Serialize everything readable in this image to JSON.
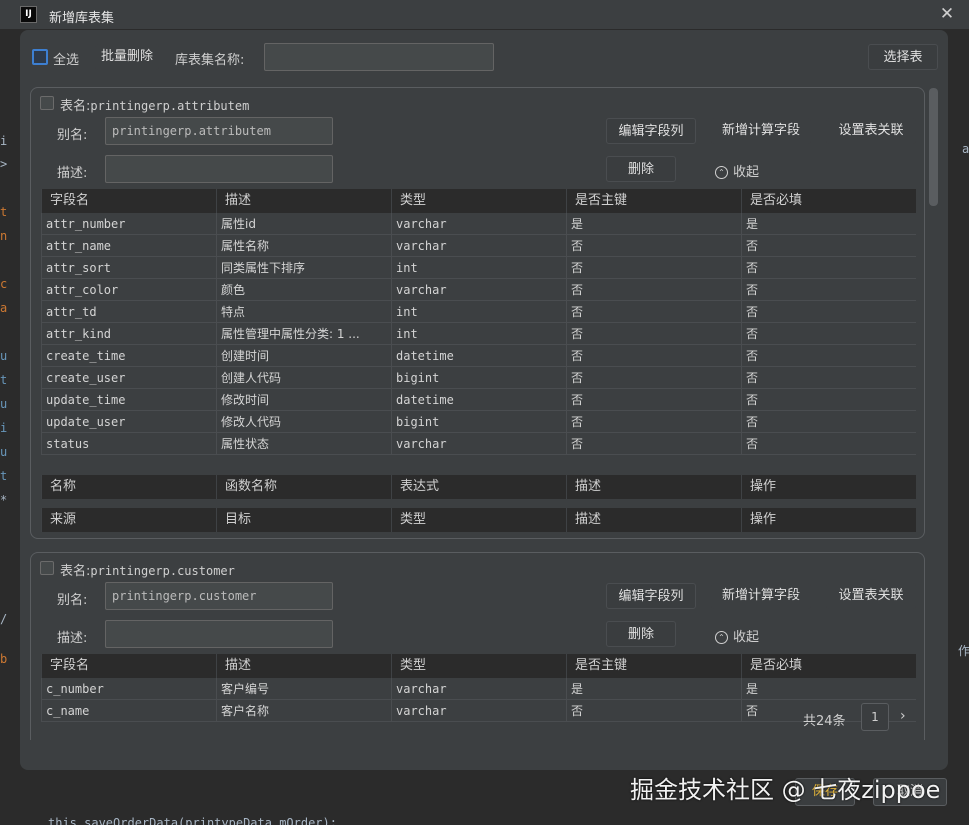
{
  "window": {
    "app_icon_text": "IJ",
    "title": "新增库表集",
    "close_glyph": "✕"
  },
  "background_code": {
    "gutter": [
      {
        "text": "i",
        "color": "#a9b7c6"
      },
      {
        "text": ">",
        "color": "#a9b7c6"
      },
      {
        "text": "t",
        "color": "#cc7832"
      },
      {
        "text": "n",
        "color": "#cc7832"
      },
      {
        "text": "c",
        "color": "#cc7832"
      },
      {
        "text": "a",
        "color": "#cc7832"
      },
      {
        "text": "u",
        "color": "#6897bb"
      },
      {
        "text": "t",
        "color": "#6897bb"
      },
      {
        "text": "u",
        "color": "#6897bb"
      },
      {
        "text": "i",
        "color": "#6897bb"
      },
      {
        "text": "u",
        "color": "#6897bb"
      },
      {
        "text": "t",
        "color": "#6897bb"
      },
      {
        "text": "*",
        "color": "#a9b7c6"
      },
      {
        "text": "/",
        "color": "#a9b7c6"
      },
      {
        "text": "b",
        "color": "#cc7832"
      }
    ],
    "right_glyphs": [
      "a",
      "作"
    ],
    "bottom_line": "this.saveOrderData(printypeData.mOrder);"
  },
  "toolbar": {
    "select_all_label": "全选",
    "batch_delete_label": "批量删除",
    "set_name_label": "库表集名称:",
    "set_name_value": "",
    "select_table_label": "选择表"
  },
  "labels": {
    "table_name": "表名:",
    "alias": "别名:",
    "description": "描述:",
    "edit_fields": "编辑字段列",
    "add_computed_field": "新增计算字段",
    "set_relation": "设置表关联",
    "delete": "删除",
    "collapse": "收起",
    "collapse_icon": "⌃"
  },
  "field_headers": [
    "字段名",
    "描述",
    "类型",
    "是否主键",
    "是否必填"
  ],
  "computed_headers": [
    "名称",
    "函数名称",
    "表达式",
    "描述",
    "操作"
  ],
  "relation_headers": [
    "来源",
    "目标",
    "类型",
    "描述",
    "操作"
  ],
  "tables": [
    {
      "name": "printingerp.attributem",
      "alias": "printingerp.attributem",
      "description": "",
      "rows": [
        [
          "attr_number",
          "属性id",
          "varchar",
          "是",
          "是"
        ],
        [
          "attr_name",
          "属性名称",
          "varchar",
          "否",
          "否"
        ],
        [
          "attr_sort",
          "同类属性下排序",
          "int",
          "否",
          "否"
        ],
        [
          "attr_color",
          "颜色",
          "varchar",
          "否",
          "否"
        ],
        [
          "attr_td",
          "特点",
          "int",
          "否",
          "否"
        ],
        [
          "attr_kind",
          "属性管理中属性分类: 1 ...",
          "int",
          "否",
          "否"
        ],
        [
          "create_time",
          "创建时间",
          "datetime",
          "否",
          "否"
        ],
        [
          "create_user",
          "创建人代码",
          "bigint",
          "否",
          "否"
        ],
        [
          "update_time",
          "修改时间",
          "datetime",
          "否",
          "否"
        ],
        [
          "update_user",
          "修改人代码",
          "bigint",
          "否",
          "否"
        ],
        [
          "status",
          "属性状态",
          "varchar",
          "否",
          "否"
        ]
      ]
    },
    {
      "name": "printingerp.customer",
      "alias": "printingerp.customer",
      "description": "",
      "rows": [
        [
          "c_number",
          "客户编号",
          "varchar",
          "是",
          "是"
        ],
        [
          "c_name",
          "客户名称",
          "varchar",
          "否",
          "否"
        ]
      ]
    }
  ],
  "pager": {
    "total_label": "共24条",
    "page": "1",
    "next_glyph": "›"
  },
  "footer": {
    "save_label": "保存",
    "cancel_label": "取消"
  },
  "watermark": "掘金技术社区 @ 七夜zippoe"
}
